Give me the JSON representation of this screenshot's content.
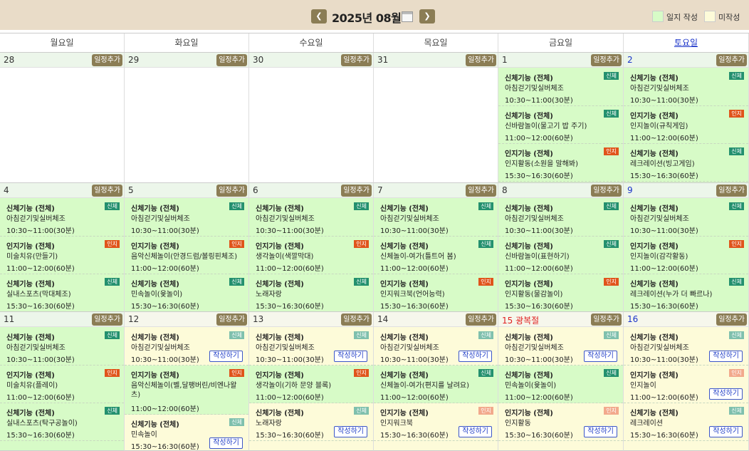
{
  "header": {
    "prev_icon": "chevron-left-icon",
    "next_icon": "chevron-right-icon",
    "prev_glyph": "❮",
    "next_glyph": "❯",
    "title": "2025년 08월",
    "calendar_icon": "calendar-icon"
  },
  "legend": [
    {
      "label": "일지 작성",
      "color": "#d7fbc7"
    },
    {
      "label": "미작성",
      "color": "#fdfbd9"
    }
  ],
  "weekdays": [
    "월요일",
    "화요일",
    "수요일",
    "목요일",
    "금요일",
    "토요일"
  ],
  "add_label": "일정추가",
  "write_label": "작성하기",
  "badges": {
    "phys": "신체",
    "cog": "인지"
  },
  "weeks": [
    [
      {
        "day": "28",
        "bg": "white",
        "events": []
      },
      {
        "day": "29",
        "bg": "white",
        "events": []
      },
      {
        "day": "30",
        "bg": "white",
        "events": []
      },
      {
        "day": "31",
        "bg": "white",
        "events": []
      },
      {
        "day": "1",
        "bg": "green",
        "events": [
          {
            "title": "신체기능 (전체)",
            "name": "아침걷기및실버체조",
            "time": "10:30~11:00(30분)",
            "badge": "phys"
          },
          {
            "title": "신체기능 (전체)",
            "name": "신바람놀이(물고기 밥 주기)",
            "time": "11:00~12:00(60분)",
            "badge": "phys"
          },
          {
            "title": "인지기능 (전체)",
            "name": "인지활동(소원을 말해봐)",
            "time": "15:30~16:30(60분)",
            "badge": "cog"
          }
        ]
      },
      {
        "day": "2",
        "bg": "green",
        "sat": true,
        "events": [
          {
            "title": "신체기능 (전체)",
            "name": "아침걷기및실버체조",
            "time": "10:30~11:00(30분)",
            "badge": "phys"
          },
          {
            "title": "인지기능 (전체)",
            "name": "인지놀이(규칙게임)",
            "time": "11:00~12:00(60분)",
            "badge": "cog"
          },
          {
            "title": "신체기능 (전체)",
            "name": "레크레이션(빙고게임)",
            "time": "15:30~16:30(60분)",
            "badge": "phys"
          }
        ]
      }
    ],
    [
      {
        "day": "4",
        "bg": "green",
        "events": [
          {
            "title": "신체기능 (전체)",
            "name": "아침걷기및실버체조",
            "time": "10:30~11:00(30분)",
            "badge": "phys"
          },
          {
            "title": "인지기능 (전체)",
            "name": "미술치유(만들기)",
            "time": "11:00~12:00(60분)",
            "badge": "cog"
          },
          {
            "title": "신체기능 (전체)",
            "name": "실내스포츠(막대체조)",
            "time": "15:30~16:30(60분)",
            "badge": "phys"
          }
        ]
      },
      {
        "day": "5",
        "bg": "green",
        "events": [
          {
            "title": "신체기능 (전체)",
            "name": "아침걷기및실버체조",
            "time": "10:30~11:00(30분)",
            "badge": "phys"
          },
          {
            "title": "인지기능 (전체)",
            "name": "음악신체놀이(안경드럼/볼링핀체조)",
            "time": "11:00~12:00(60분)",
            "badge": "cog"
          },
          {
            "title": "신체기능 (전체)",
            "name": "민속놀이(윷놀이)",
            "time": "15:30~16:30(60분)",
            "badge": "phys"
          }
        ]
      },
      {
        "day": "6",
        "bg": "green",
        "events": [
          {
            "title": "신체기능 (전체)",
            "name": "아침걷기및실버체조",
            "time": "10:30~11:00(30분)",
            "badge": "phys"
          },
          {
            "title": "인지기능 (전체)",
            "name": "생각놀이(색깔막대)",
            "time": "11:00~12:00(60분)",
            "badge": "cog"
          },
          {
            "title": "신체기능 (전체)",
            "name": "노래자랑",
            "time": "15:30~16:30(60분)",
            "badge": "phys"
          }
        ]
      },
      {
        "day": "7",
        "bg": "green",
        "events": [
          {
            "title": "신체기능 (전체)",
            "name": "아침걷기및실버체조",
            "time": "10:30~11:00(30분)",
            "badge": "phys"
          },
          {
            "title": "신체기능 (전체)",
            "name": "신체놀이-여가(틀트어 봄)",
            "time": "11:00~12:00(60분)",
            "badge": "phys"
          },
          {
            "title": "인지기능 (전체)",
            "name": "인지워크북(언어능력)",
            "time": "15:30~16:30(60분)",
            "badge": "cog"
          }
        ]
      },
      {
        "day": "8",
        "bg": "green",
        "events": [
          {
            "title": "신체기능 (전체)",
            "name": "아침걷기및실버체조",
            "time": "10:30~11:00(30분)",
            "badge": "phys"
          },
          {
            "title": "신체기능 (전체)",
            "name": "신바람놀이(표현하기)",
            "time": "11:00~12:00(60분)",
            "badge": "phys"
          },
          {
            "title": "인지기능 (전체)",
            "name": "인지활동(물감놀이)",
            "time": "15:30~16:30(60분)",
            "badge": "cog"
          }
        ]
      },
      {
        "day": "9",
        "bg": "green",
        "sat": true,
        "events": [
          {
            "title": "신체기능 (전체)",
            "name": "아침걷기및실버체조",
            "time": "10:30~11:00(30분)",
            "badge": "phys"
          },
          {
            "title": "인지기능 (전체)",
            "name": "인지놀이(감각활동)",
            "time": "11:00~12:00(60분)",
            "badge": "cog"
          },
          {
            "title": "신체기능 (전체)",
            "name": "레크레이션(누가 더 빠르나)",
            "time": "15:30~16:30(60분)",
            "badge": "phys"
          }
        ]
      }
    ],
    [
      {
        "day": "11",
        "bg": "green",
        "events": [
          {
            "title": "신체기능 (전체)",
            "name": "아침걷기및실버체조",
            "time": "10:30~11:00(30분)",
            "badge": "phys"
          },
          {
            "title": "인지기능 (전체)",
            "name": "미술치유(플레이)",
            "time": "11:00~12:00(60분)",
            "badge": "cog"
          },
          {
            "title": "신체기능 (전체)",
            "name": "실내스포츠(탁구공놀이)",
            "time": "15:30~16:30(60분)",
            "badge": "phys"
          }
        ]
      },
      {
        "day": "12",
        "bg": "yellow",
        "events": [
          {
            "title": "신체기능 (전체)",
            "name": "아침걷기및실버체조",
            "time": "10:30~11:00(30분)",
            "badge": "phys",
            "dim": true,
            "write": true
          },
          {
            "title": "인지기능 (전체)",
            "name": "음악신체놀이(벨,달팽버린/비엔나왈츠)",
            "time": "11:00~12:00(60분)",
            "badge": "cog",
            "tall": true,
            "green": true
          },
          {
            "title": "신체기능 (전체)",
            "name": "민속놀이",
            "time": "15:30~16:30(60분)",
            "badge": "phys",
            "dim": true,
            "write": true
          }
        ]
      },
      {
        "day": "13",
        "bg": "yellow",
        "events": [
          {
            "title": "신체기능 (전체)",
            "name": "아침걷기및실버체조",
            "time": "10:30~11:00(30분)",
            "badge": "phys",
            "dim": true,
            "write": true
          },
          {
            "title": "인지기능 (전체)",
            "name": "생각놀이(기하 문양 블록)",
            "time": "11:00~12:00(60분)",
            "badge": "cog",
            "green": true
          },
          {
            "title": "신체기능 (전체)",
            "name": "노래자랑",
            "time": "15:30~16:30(60분)",
            "badge": "phys",
            "dim": true,
            "write": true
          }
        ]
      },
      {
        "day": "14",
        "bg": "yellow",
        "events": [
          {
            "title": "신체기능 (전체)",
            "name": "아침걷기및실버체조",
            "time": "10:30~11:00(30분)",
            "badge": "phys",
            "dim": true,
            "write": true
          },
          {
            "title": "신체기능 (전체)",
            "name": "신체놀이-여가(편지를 날려요)",
            "time": "11:00~12:00(60분)",
            "badge": "phys",
            "green": true
          },
          {
            "title": "인지기능 (전체)",
            "name": "인지워크북",
            "time": "15:30~16:30(60분)",
            "badge": "cog",
            "dim": true,
            "write": true
          }
        ]
      },
      {
        "day": "15 광복절",
        "bg": "yellow",
        "hol": true,
        "events": [
          {
            "title": "신체기능 (전체)",
            "name": "아침걷기및실버체조",
            "time": "10:30~11:00(30분)",
            "badge": "phys",
            "dim": true,
            "write": true
          },
          {
            "title": "신체기능 (전체)",
            "name": "민속놀이(윷놀이)",
            "time": "11:00~12:00(60분)",
            "badge": "phys",
            "green": true
          },
          {
            "title": "인지기능 (전체)",
            "name": "인지활동",
            "time": "15:30~16:30(60분)",
            "badge": "cog",
            "dim": true,
            "write": true
          }
        ]
      },
      {
        "day": "16",
        "bg": "yellow",
        "sat": true,
        "events": [
          {
            "title": "신체기능 (전체)",
            "name": "아침걷기및실버체조",
            "time": "10:30~11:00(30분)",
            "badge": "phys",
            "dim": true,
            "write": true
          },
          {
            "title": "인지기능 (전체)",
            "name": "인지놀이",
            "time": "11:00~12:00(60분)",
            "badge": "cog",
            "dim": true,
            "write": true
          },
          {
            "title": "신체기능 (전체)",
            "name": "레크레이션",
            "time": "15:30~16:30(60분)",
            "badge": "phys",
            "dim": true,
            "write": true
          }
        ]
      }
    ]
  ]
}
